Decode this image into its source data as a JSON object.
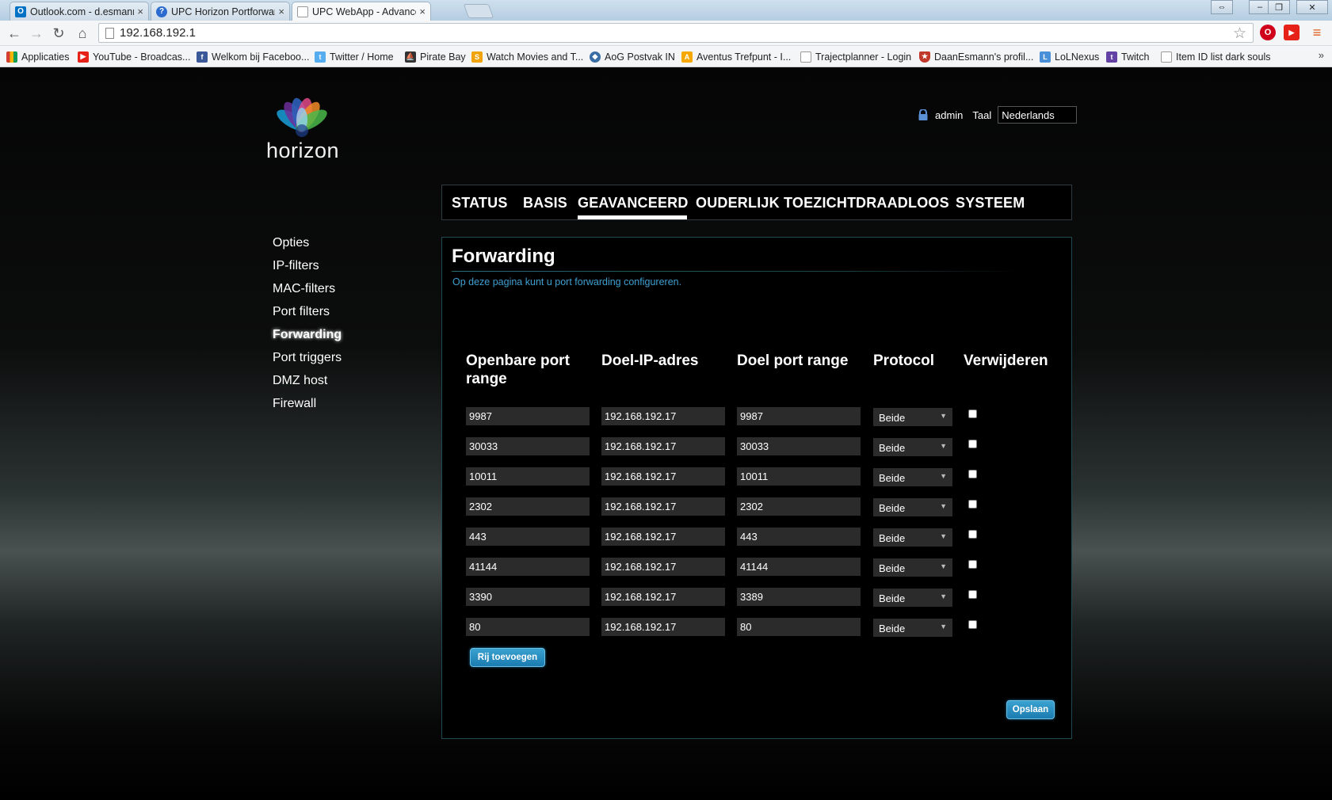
{
  "browser": {
    "tabs": [
      {
        "title": "Outlook.com - d.esmann",
        "icon": "outlook-icon",
        "color": "#0072c6",
        "glyph": "O"
      },
      {
        "title": "UPC Horizon Portforwardi",
        "icon": "help-icon",
        "color": "#2b6bcf",
        "glyph": "?"
      },
      {
        "title": "UPC WebApp - Advanced",
        "icon": "page-icon",
        "color": "#ffffff",
        "glyph": ""
      }
    ],
    "close_glyph": "×",
    "url": "192.168.192.1",
    "bookmarks": [
      {
        "label": "Applicaties",
        "icon": "apps-icon",
        "color": "#d23f31"
      },
      {
        "label": "YouTube - Broadcas...",
        "icon": "youtube-icon",
        "color": "#e62117"
      },
      {
        "label": "Welkom bij Faceboo...",
        "icon": "facebook-icon",
        "color": "#3b5998"
      },
      {
        "label": "Twitter / Home",
        "icon": "twitter-icon",
        "color": "#55acee"
      },
      {
        "label": "Pirate Bay",
        "icon": "pirate-ship-icon",
        "color": "#333333"
      },
      {
        "label": "Watch Movies and T...",
        "icon": "movie-icon",
        "color": "#f0a30a"
      },
      {
        "label": "AoG Postvak IN",
        "icon": "mail-icon",
        "color": "#3a6ea5"
      },
      {
        "label": "Aventus Trefpunt - I...",
        "icon": "aventus-icon",
        "color": "#f6a800"
      },
      {
        "label": "Trajectplanner - Login",
        "icon": "page-icon",
        "color": "#ffffff"
      },
      {
        "label": "DaanEsmann's profil...",
        "icon": "shield-icon",
        "color": "#c0392b"
      },
      {
        "label": "LoLNexus",
        "icon": "lolnexus-icon",
        "color": "#4a90d9"
      },
      {
        "label": "Twitch",
        "icon": "twitch-icon",
        "color": "#6441a5"
      },
      {
        "label": "Item ID list dark souls",
        "icon": "page-icon",
        "color": "#ffffff"
      }
    ],
    "more_glyph": "»"
  },
  "header": {
    "logo_text": "horizon",
    "user": "admin",
    "language_label": "Taal",
    "language_value": "Nederlands"
  },
  "main_nav": [
    {
      "label": "STATUS",
      "active": false
    },
    {
      "label": "BASIS",
      "active": false
    },
    {
      "label": "GEAVANCEERD",
      "active": true
    },
    {
      "label": "OUDERLIJK TOEZICHT",
      "active": false
    },
    {
      "label": "DRAADLOOS",
      "active": false
    },
    {
      "label": "SYSTEEM",
      "active": false
    }
  ],
  "side_nav": [
    {
      "label": "Opties",
      "active": false
    },
    {
      "label": "IP-filters",
      "active": false
    },
    {
      "label": "MAC-filters",
      "active": false
    },
    {
      "label": "Port filters",
      "active": false
    },
    {
      "label": "Forwarding",
      "active": true
    },
    {
      "label": "Port triggers",
      "active": false
    },
    {
      "label": "DMZ host",
      "active": false
    },
    {
      "label": "Firewall",
      "active": false
    }
  ],
  "content": {
    "title": "Forwarding",
    "description": "Op deze pagina kunt u port forwarding configureren.",
    "columns": {
      "public_port_line1": "Openbare port",
      "public_port_line2": "range",
      "target_ip": "Doel-IP-adres",
      "target_port": "Doel port range",
      "protocol": "Protocol",
      "delete": "Verwijderen"
    },
    "rows": [
      {
        "public_port": "9987",
        "target_ip": "192.168.192.17",
        "target_port": "9987",
        "protocol": "Beide",
        "delete": false
      },
      {
        "public_port": "30033",
        "target_ip": "192.168.192.17",
        "target_port": "30033",
        "protocol": "Beide",
        "delete": false
      },
      {
        "public_port": "10011",
        "target_ip": "192.168.192.17",
        "target_port": "10011",
        "protocol": "Beide",
        "delete": false
      },
      {
        "public_port": "2302",
        "target_ip": "192.168.192.17",
        "target_port": "2302",
        "protocol": "Beide",
        "delete": false
      },
      {
        "public_port": "443",
        "target_ip": "192.168.192.17",
        "target_port": "443",
        "protocol": "Beide",
        "delete": false
      },
      {
        "public_port": "41144",
        "target_ip": "192.168.192.17",
        "target_port": "41144",
        "protocol": "Beide",
        "delete": false
      },
      {
        "public_port": "3390",
        "target_ip": "192.168.192.17",
        "target_port": "3389",
        "protocol": "Beide",
        "delete": false
      },
      {
        "public_port": "80",
        "target_ip": "192.168.192.17",
        "target_port": "80",
        "protocol": "Beide",
        "delete": false
      }
    ],
    "add_row_label": "Rij toevoegen",
    "save_label": "Opslaan"
  },
  "colors": {
    "accent_blue": "#3e9fd0",
    "button_blue": "#1b7bb0",
    "field_bg": "#2b2b2b"
  }
}
